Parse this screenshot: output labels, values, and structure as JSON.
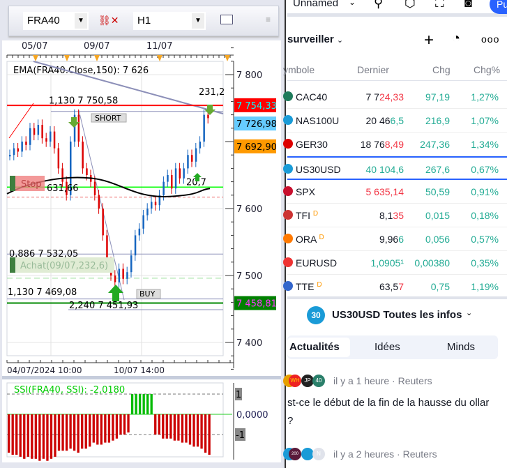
{
  "toolbar": {
    "symbol": "FRA40",
    "timeframe": "H1"
  },
  "chart": {
    "date_ticks": [
      "05/07",
      "09/07",
      "11/07"
    ],
    "bottom_dates": [
      "04/07/2024 10:00",
      "10/07 14:00"
    ],
    "indicator_label": "EMA(FRA40.Close,150): 7 626",
    "price_ticks": [
      "7 800",
      "7 600",
      "7 500",
      "7 400"
    ],
    "price_tick_values": [
      7800,
      7600,
      7500,
      7400
    ],
    "price_labels": [
      {
        "text": "7 754,33",
        "bg": "#ff0000",
        "fg": "#00ffff",
        "value": 7754.33
      },
      {
        "text": "7 726,98",
        "bg": "#66ccff",
        "fg": "#000000",
        "value": 7726.98
      },
      {
        "text": "7 692,90",
        "bg": "#ff9900",
        "fg": "#000000",
        "value": 7692.9
      },
      {
        "text": "7 458,81",
        "bg": "#008000",
        "fg": "#ff33ff",
        "value": 7458.81
      }
    ],
    "annotations": {
      "fib1": "1,130 7 750,58",
      "fib2": "0,886 7 532,05",
      "fib3": "1,130 7 469,08",
      "fib4": "2,240 7 451,93",
      "top_right": "231,2",
      "mid": "20,7",
      "stop_value": "631,66",
      "short_label": "SHORT",
      "buy_label": "BUY",
      "stop_label": "Stop",
      "achat_label": "Achat(09/07,232,6)"
    },
    "closes": [
      7680,
      7690,
      7685,
      7700,
      7695,
      7720,
      7710,
      7725,
      7705,
      7700,
      7715,
      7690,
      7660,
      7640,
      7620,
      7700,
      7740,
      7700,
      7660,
      7650,
      7640,
      7620,
      7600,
      7560,
      7520,
      7500,
      7490,
      7510,
      7495,
      7505,
      7530,
      7560,
      7570,
      7590,
      7600,
      7610,
      7605,
      7620,
      7640,
      7650,
      7630,
      7660,
      7645,
      7660,
      7680,
      7670,
      7690,
      7700,
      7740,
      7735
    ],
    "ssi_label": "SSI(FRA40, SSI): -2,0180",
    "ssi_ticks": [
      "1",
      "0,0000",
      "-1"
    ],
    "ssi_values": [
      -1.9,
      -2,
      -2,
      -2.1,
      -2.2,
      -2.1,
      -2.2,
      -2.2,
      -2.3,
      -2.2,
      -2.3,
      -2.2,
      -2.1,
      -1.8,
      -1.8,
      -1.8,
      -1.7,
      -1.8,
      -1.9,
      -1.7,
      -1.7,
      -1.6,
      -1.4,
      -1.5,
      -1.5,
      -1.4,
      -1.4,
      -1.3,
      -1.2,
      -1.0,
      -1.0,
      -0.9,
      1,
      1,
      1,
      1,
      1,
      1,
      -1.0,
      -1.0,
      -1.2,
      -1.2,
      -1.2,
      -1.3,
      -1.3,
      -1.4,
      -1.4,
      -1.5,
      -1.6,
      -1.6,
      -1.7,
      -1.9,
      -2.0
    ]
  },
  "right": {
    "layout_name": "Unnamed",
    "publish": "Pu",
    "watchlist_title": "surveiller",
    "columns": [
      "ymbole",
      "Dernier",
      "Chg",
      "Chg%"
    ],
    "rows": [
      {
        "sym": "CAC40",
        "last_a": "7 7",
        "last_b": "24,33",
        "last_color": "r",
        "chg": "97,19",
        "pct": "1,27%",
        "logo": "#1e7b5b"
      },
      {
        "sym": "NAS100U",
        "last_a": "20 46",
        "last_b": "6,5",
        "last_color": "g",
        "chg": "216,9",
        "pct": "1,07%",
        "logo": "#1a9bd7"
      },
      {
        "sym": "GER30",
        "last_a": "18 76",
        "last_b": "8,49",
        "last_color": "r",
        "chg": "247,36",
        "pct": "1,34%",
        "logo": "#d00"
      },
      {
        "sym": "US30USD",
        "last_a": "",
        "last_b": "40 104,6",
        "last_color": "g",
        "chg": "267,6",
        "pct": "0,67%",
        "logo": "#1a9bd7"
      },
      {
        "sym": "SPX",
        "last_a": "",
        "last_b": "5 635,14",
        "last_color": "r",
        "chg": "50,59",
        "pct": "0,91%",
        "logo": "#c8102e"
      },
      {
        "sym": "TFI",
        "d": "D",
        "last_a": "8,1",
        "last_b": "35",
        "last_color": "r",
        "chg": "0,015",
        "pct": "0,18%",
        "logo": "#c33"
      },
      {
        "sym": "ORA",
        "d": "D",
        "last_a": "9,96",
        "last_b": "6",
        "last_color": "g",
        "chg": "0,056",
        "pct": "0,57%",
        "logo": "#ff7900"
      },
      {
        "sym": "EURUSD",
        "last_a": "",
        "last_b": "1,0905¹",
        "last_color": "g",
        "chg": "0,00380",
        "pct": "0,35%",
        "logo": "#e33"
      },
      {
        "sym": "TTE",
        "d": "D",
        "last_a": "63,5",
        "last_b": "7",
        "last_color": "r",
        "chg": "0,75",
        "pct": "1,19%",
        "logo": "#36c"
      }
    ],
    "news_badge": "30",
    "news_title": "US30USD Toutes les infos",
    "tabs": [
      "Actualités",
      "Idées",
      "Minds"
    ],
    "news": [
      {
        "meta": "il y a 1 heure · Reuters",
        "text": "st-ce le début de la fin de la hausse du ollar ?",
        "av": [
          "WH",
          "JP",
          "40"
        ]
      },
      {
        "meta": "il y a 2 heures · Reuters",
        "av": [
          "200",
          "",
          "N"
        ]
      }
    ]
  }
}
